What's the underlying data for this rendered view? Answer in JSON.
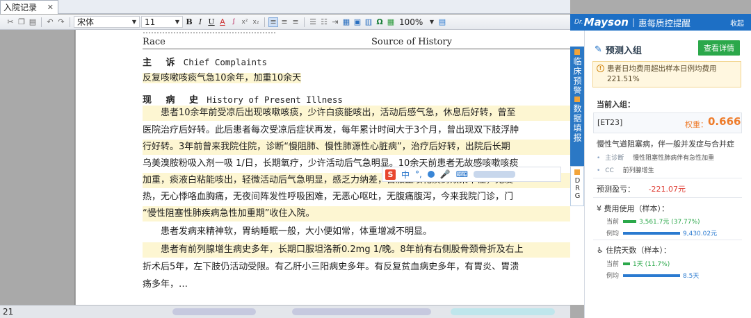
{
  "tab": {
    "title": "入院记录",
    "close": "✕"
  },
  "toolbar": {
    "font_name": "宋体",
    "font_size": "11",
    "zoom": "100%",
    "bold": "B",
    "italic": "I",
    "underline": "U",
    "omega": "Ω"
  },
  "document": {
    "top_cut": "…………………………………………",
    "race_label": "Race",
    "source_label": "Source of History",
    "complaint_head_cn": "主  诉",
    "complaint_head_en": "Chief Complaints",
    "complaint_text": "反复咳嗽咳痰气急10余年，加重10余天",
    "hpi_head_cn": "现 病 史",
    "hpi_head_en": "History of Present Illness",
    "hpi_lines": [
      "　　患者10余年前受凉后出现咳嗽咳痰，少许白痰能咳出，活动后感气急，休息后好转，曾至",
      "医院治疗后好转。此后患者每次受凉后症状再发，每年累计时间大于3个月，曾出现双下肢浮肿",
      "行好转。3年前曾来我院住院，诊断“慢阻肺、慢性肺源性心脏病”，治疗后好转，出院后长期",
      "乌美溴胺粉吸入剂一吸 1/日，长期氧疗，少许活动后气急明显。10余天前患者无故感咳嗽咳痰",
      "加重，痰液白粘能咳出，轻微活动后气急明显，感乏力纳差，自服止咳化痰药效果不佳，无发",
      "热，无心悸咯血胸痛，无夜间阵发性呼吸困难，无恶心呕吐，无腹痛腹泻，今来我院门诊，门",
      "“慢性阻塞性肺疾病急性加重期”收住入院。",
      "　　患者发病来精神软，胃纳睡眠一般，大小便如常，体重增减不明显。",
      "　　患者有前列腺增生病史多年，长期口服坦洛新0.2mg 1/晚。8年前有右侧股骨颈骨折及右上",
      "折术后5年，左下肢仍活动受限。有乙肝小三阳病史多年。有反复贫血病史多年，有胃炎、胃溃",
      "疡多年，…"
    ]
  },
  "ime": {
    "logo": "S",
    "lang": "中",
    "punct": "°,"
  },
  "statusbar": {
    "page": "21"
  },
  "vtabs": [
    {
      "label": "临床预警"
    },
    {
      "label": "数据填报"
    },
    {
      "label": "DRG"
    }
  ],
  "panel": {
    "dr": "Dr.",
    "brand": "Mayson",
    "divider": "|",
    "title": "惠每质控提醒",
    "collapse": "收起",
    "pred_title": "预测入组",
    "detail_button": "查看详情",
    "alert_line1": "患者日均费用超出样本日例均费用",
    "alert_line2": "221.51%",
    "current_group_label": "当前入组：",
    "group_code": "[ET23]",
    "weight_label": "权重：",
    "weight_value": "0.666",
    "diagnosis": "慢性气道阻塞病，伴一般并发症与合并症",
    "sub_rows": [
      {
        "tag": "主诊断",
        "text": "慢性阻塞性肺病伴有急性加重"
      },
      {
        "tag": "CC",
        "text": "前列腺增生"
      }
    ],
    "profit_label": "预测盈亏：",
    "profit_value": "-221.07元",
    "cost_head": "费用使用（样本）：",
    "cost_current_label": "当前",
    "cost_current_value": "3,561.7元 (37.77%)",
    "cost_average_label": "例均",
    "cost_average_value": "9,430.02元",
    "days_head": "住院天数（样本）：",
    "days_current_label": "当前",
    "days_current_value": "1天 (11.7%)",
    "days_average_label": "例均",
    "days_average_value": "8.5天",
    "cost_current_fraction": 0.3777,
    "days_current_fraction": 0.117
  }
}
